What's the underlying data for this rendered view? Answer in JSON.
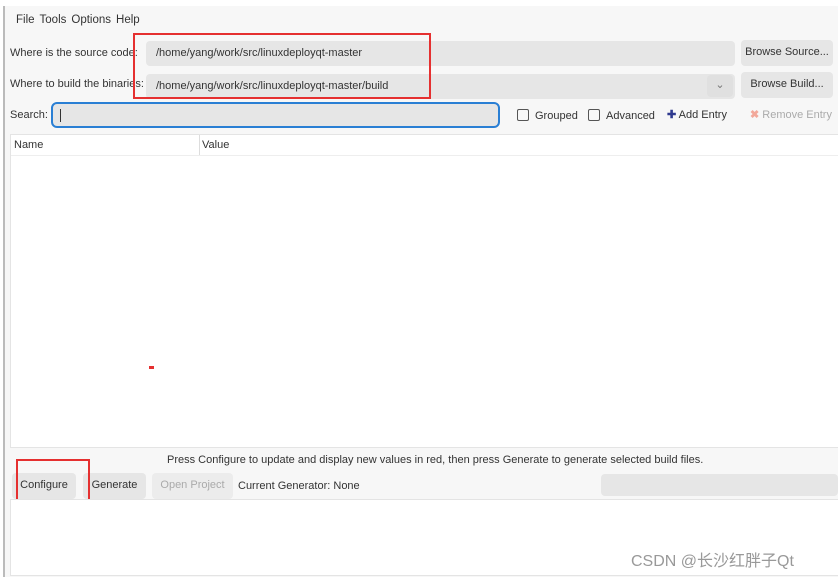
{
  "menu": [
    "File",
    "Tools",
    "Options",
    "Help"
  ],
  "source": {
    "label": "Where is the source code:",
    "value": "/home/yang/work/src/linuxdeployqt-master",
    "button": "Browse Source..."
  },
  "build": {
    "label": "Where to build the binaries:",
    "value": "/home/yang/work/src/linuxdeployqt-master/build",
    "button": "Browse Build..."
  },
  "search": {
    "label": "Search:",
    "value": ""
  },
  "options": {
    "grouped": "Grouped",
    "advanced": "Advanced",
    "add": "Add Entry",
    "remove": "Remove Entry"
  },
  "table": {
    "columns": [
      "Name",
      "Value"
    ]
  },
  "hint": "Press Configure to update and display new values in red, then press Generate to generate selected build files.",
  "buttons": {
    "configure": "Configure",
    "generate": "Generate",
    "open": "Open Project"
  },
  "generator": "Current Generator: None",
  "watermark": "CSDN @长沙红胖子Qt",
  "colors": {
    "highlight": "#e53030",
    "focus": "#2a7fd4",
    "add_icon": "#2f3a8f",
    "remove_icon": "#f2a89a"
  }
}
